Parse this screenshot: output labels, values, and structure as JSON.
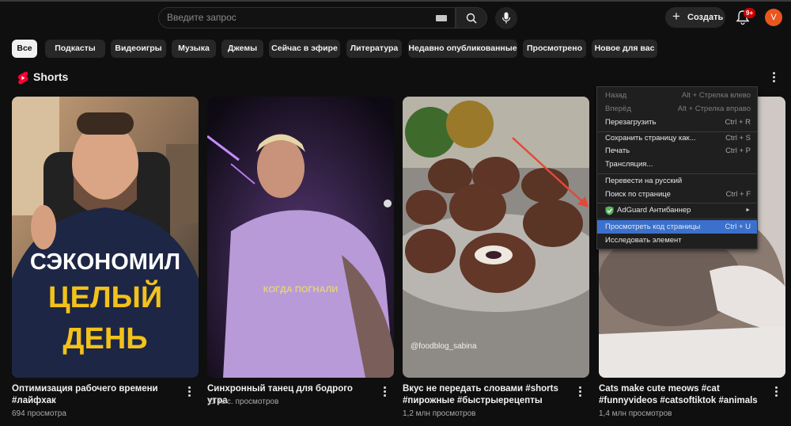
{
  "header": {
    "search_placeholder": "Введите запрос",
    "create_label": "Создать",
    "notifications_badge": "9+",
    "avatar_letter": "V"
  },
  "chips": [
    {
      "label": "Все",
      "active": true
    },
    {
      "label": "Подкасты"
    },
    {
      "label": "Видеоигры"
    },
    {
      "label": "Музыка"
    },
    {
      "label": "Джемы"
    },
    {
      "label": "Сейчас в эфире"
    },
    {
      "label": "Литература"
    },
    {
      "label": "Недавно опубликованные"
    },
    {
      "label": "Просмотрено"
    },
    {
      "label": "Новое для вас"
    }
  ],
  "shorts": {
    "section_title": "Shorts",
    "cards": [
      {
        "title": "Оптимизация рабочего времени #лайфхак",
        "views": "694 просмотра",
        "overlay": [
          "СЭКОНОМИЛ",
          "ЦЕЛЫЙ",
          "ДЕНЬ"
        ]
      },
      {
        "title": "Синхронный танец для бодрого утра",
        "views": "11 тыс. просмотров",
        "overlay": [
          "КОГДА ПОГНАЛИ"
        ]
      },
      {
        "title": "Вкус не передать словами #shorts #пирожные #быстрыерецепты",
        "views": "1,2 млн просмотров",
        "overlay": [
          "@foodblog_sabina"
        ]
      },
      {
        "title": "Cats make cute meows #cat #funnyvideos #catsoftiktok #animals",
        "views": "1,4 млн просмотров"
      }
    ]
  },
  "context_menu": {
    "items": [
      {
        "label": "Назад",
        "shortcut": "Alt + Стрелка влево",
        "disabled": true
      },
      {
        "label": "Вперёд",
        "shortcut": "Alt + Стрелка вправо",
        "disabled": true
      },
      {
        "label": "Перезагрузить",
        "shortcut": "Ctrl + R"
      },
      {
        "label": "Сохранить страницу как...",
        "shortcut": "Ctrl + S"
      },
      {
        "label": "Печать",
        "shortcut": "Ctrl + P"
      },
      {
        "label": "Трансляция..."
      },
      {
        "label": "Перевести на русский"
      },
      {
        "label": "Поиск по странице",
        "shortcut": "Ctrl + F"
      },
      {
        "label": "AdGuard Антибаннер",
        "submenu": "►"
      },
      {
        "label": "Просмотреть код страницы",
        "shortcut": "Ctrl + U",
        "highlighted": true
      },
      {
        "label": "Исследовать элемент"
      }
    ]
  }
}
